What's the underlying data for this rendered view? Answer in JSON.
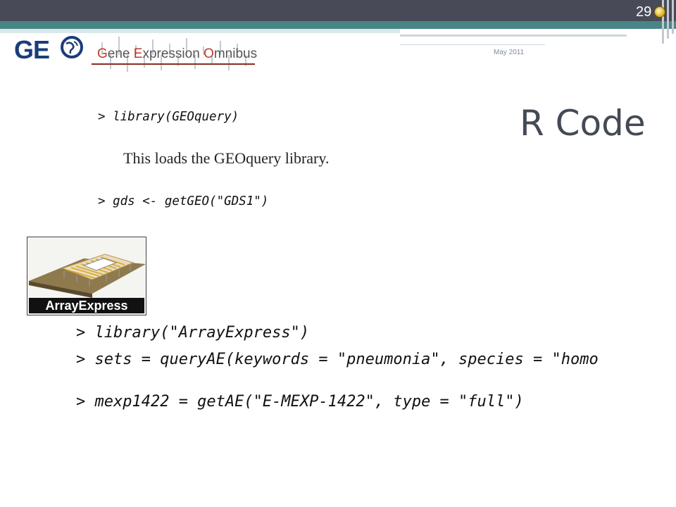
{
  "header": {
    "page_number": "29",
    "date": "May 2011"
  },
  "geo_logo": {
    "brand": "GE",
    "subtitle_parts": [
      "G",
      "ene ",
      "E",
      "xpression ",
      "O",
      "mnibus"
    ]
  },
  "slide": {
    "title": "R Code"
  },
  "geo_section": {
    "code1": "> library(GEOquery)",
    "caption": "This loads the GEOquery library.",
    "code2": "> gds <- getGEO(\"GDS1\")"
  },
  "ae_logo": {
    "label": "ArrayExpress"
  },
  "ae_section": {
    "code1": "> library(\"ArrayExpress\")",
    "code2": "> sets = queryAE(keywords = \"pneumonia\", species = \"homo",
    "code3": "> mexp1422 = getAE(\"E-MEXP-1422\", type = \"full\")"
  },
  "colors": {
    "header_dark": "#484a57",
    "header_teal": "#4a8585",
    "geo_blue": "#1a3d7a",
    "geo_red": "#c0392b"
  }
}
